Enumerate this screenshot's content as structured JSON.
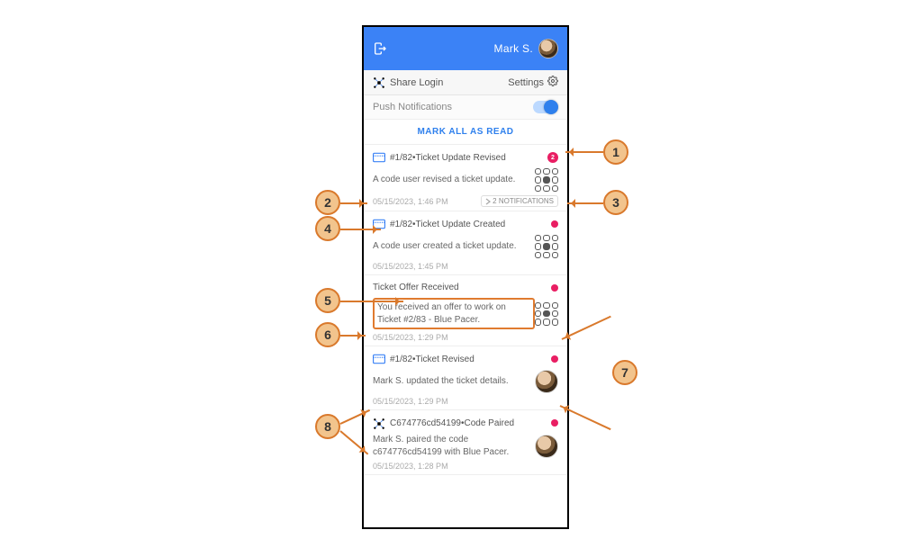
{
  "header": {
    "username": "Mark S."
  },
  "subbar": {
    "share": "Share Login",
    "settings": "Settings"
  },
  "pushbar": {
    "label": "Push Notifications"
  },
  "mark_all": "MARK ALL AS READ",
  "items": [
    {
      "iconType": "ticket",
      "titlePrefix": "#1/82",
      "title": "Ticket Update Revised",
      "badgeCount": "2",
      "body": "A code user revised a ticket update.",
      "rightType": "qr",
      "timestamp": "05/15/2023, 1:46 PM",
      "chip": "2 NOTIFICATIONS"
    },
    {
      "iconType": "ticket",
      "titlePrefix": "#1/82",
      "title": "Ticket Update Created",
      "body": "A code user created a ticket update.",
      "rightType": "qr",
      "timestamp": "05/15/2023, 1:45 PM"
    },
    {
      "iconType": "none",
      "title": "Ticket Offer Received",
      "body": "You received an offer to work on Ticket #2/83 - Blue Pacer.",
      "bodyHighlighted": true,
      "rightType": "qr",
      "timestamp": "05/15/2023, 1:29 PM"
    },
    {
      "iconType": "ticket",
      "titlePrefix": "#1/82",
      "title": "Ticket Revised",
      "body": "Mark S. updated the ticket details.",
      "rightType": "avatar",
      "timestamp": "05/15/2023, 1:29 PM"
    },
    {
      "iconType": "drone",
      "titlePrefix": "C674776cd54199",
      "title": "Code Paired",
      "body": "Mark S. paired the code c674776cd54199 with Blue Pacer.",
      "rightType": "avatar",
      "timestamp": "05/15/2023, 1:28 PM"
    }
  ],
  "callouts": {
    "1": "1",
    "2": "2",
    "3": "3",
    "4": "4",
    "5": "5",
    "6": "6",
    "7": "7",
    "8": "8"
  }
}
